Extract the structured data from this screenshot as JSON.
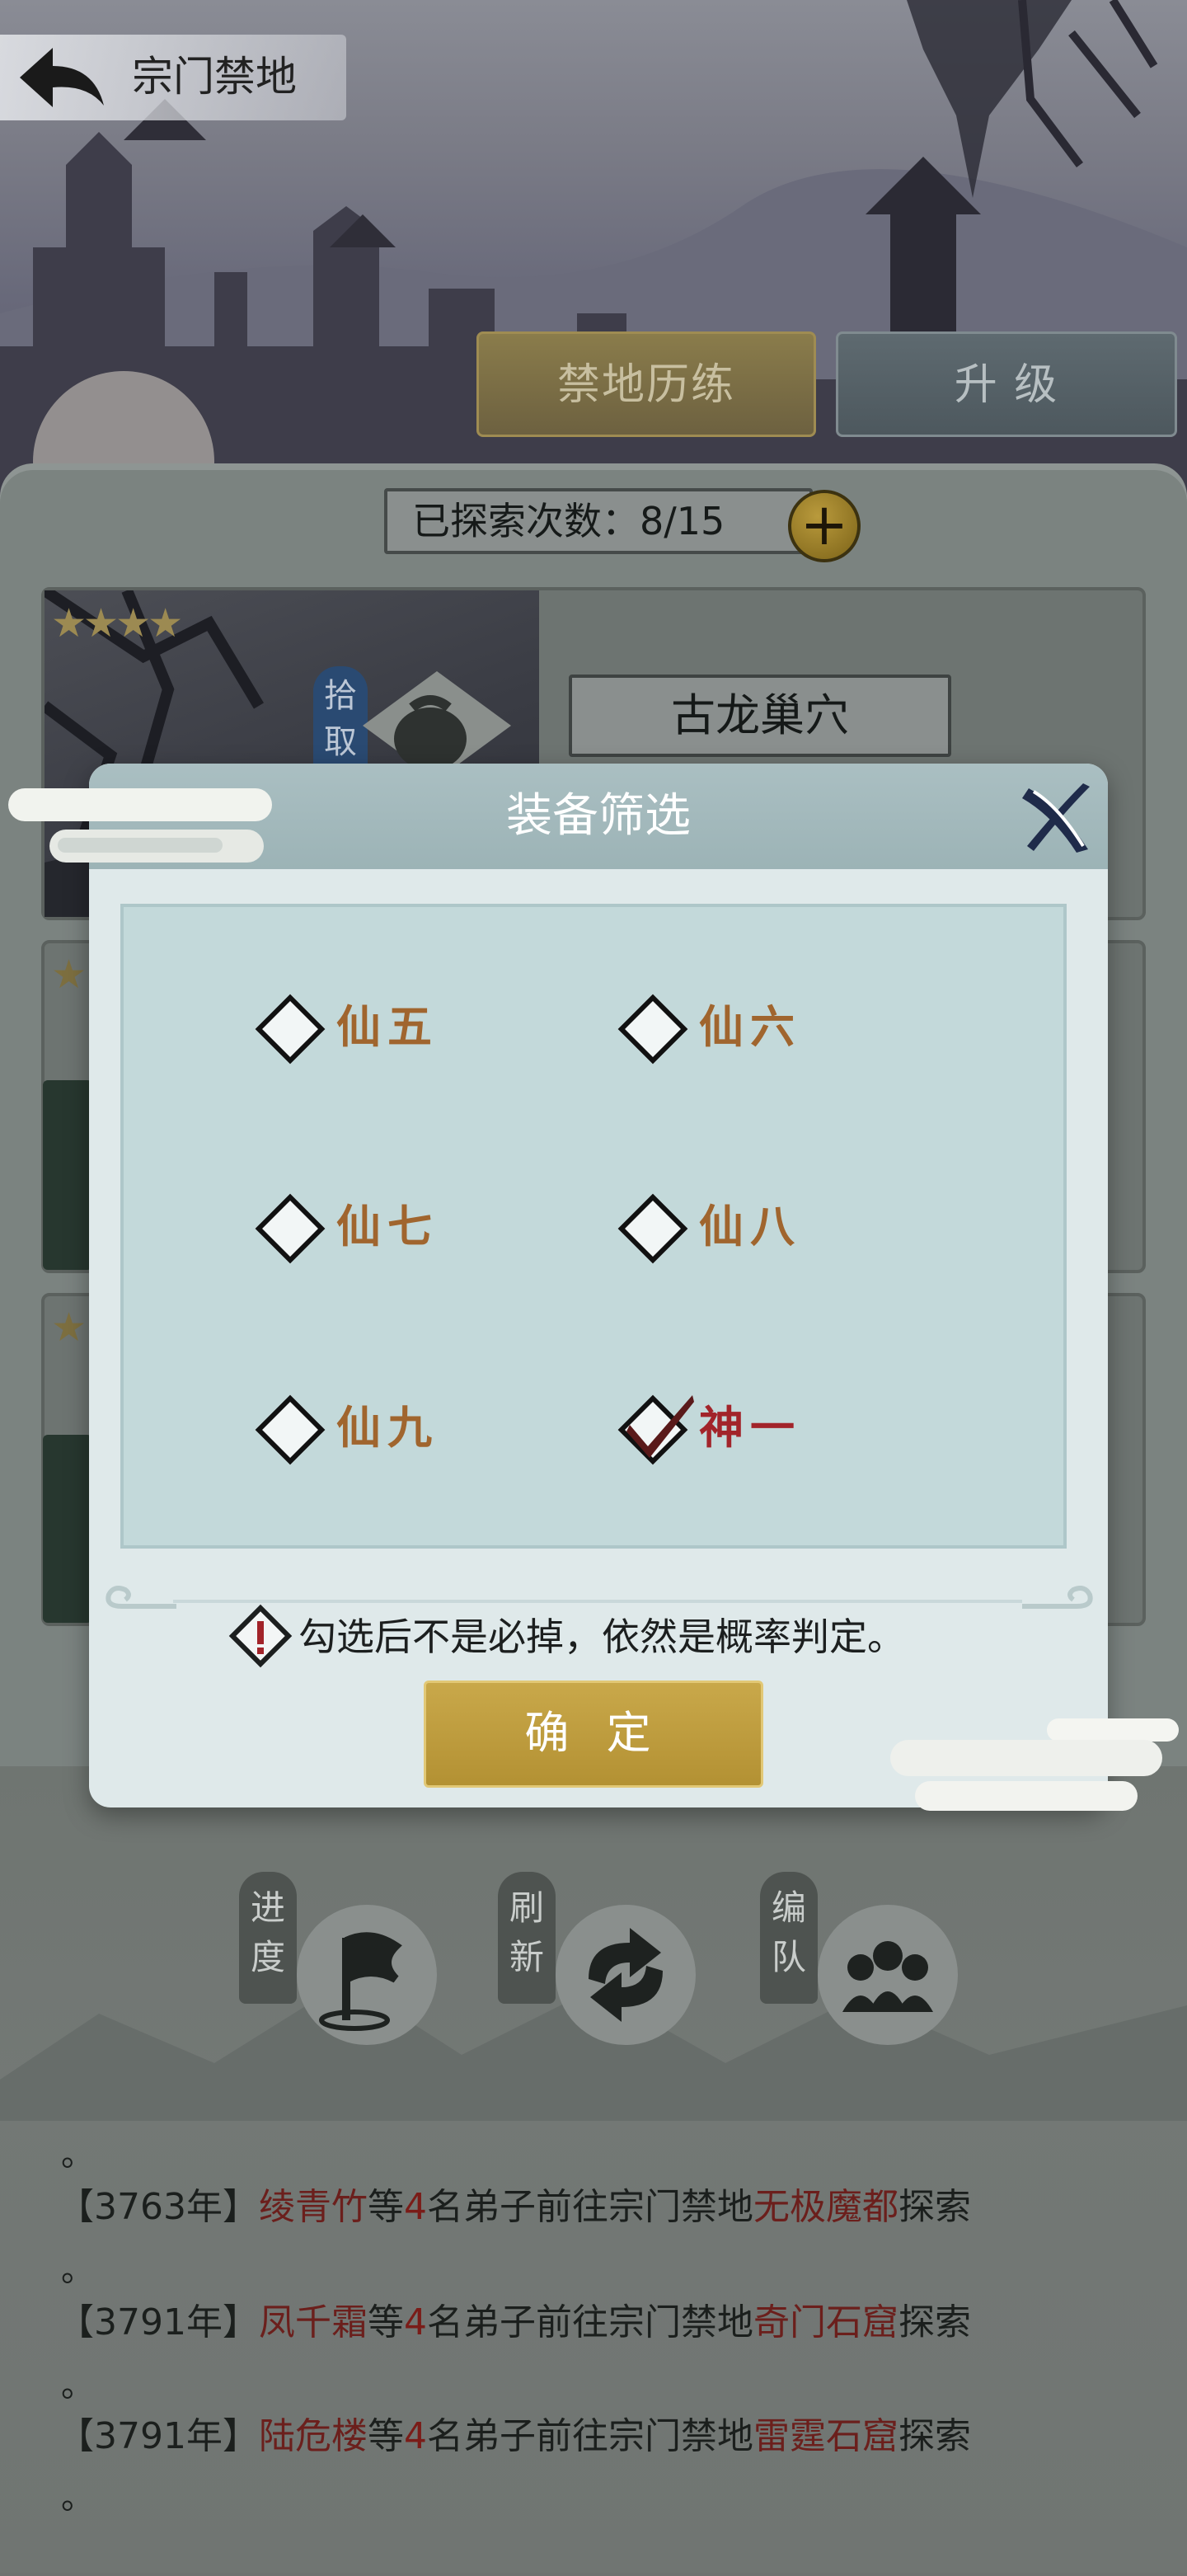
{
  "header": {
    "title": "宗门禁地"
  },
  "tabs": [
    {
      "label": "禁地历练",
      "active": true
    },
    {
      "label": "升 级",
      "active": false
    }
  ],
  "explore": {
    "label": "已探索次数：8/15"
  },
  "cards": [
    {
      "stars": "★★★★",
      "badge": "拾取",
      "location": "古龙巢穴"
    }
  ],
  "actions": [
    {
      "label": "进度",
      "icon": "flag-icon"
    },
    {
      "label": "刷新",
      "icon": "refresh-icon"
    },
    {
      "label": "编队",
      "icon": "team-icon"
    }
  ],
  "log": [
    {
      "year": "【3763年】",
      "who": "绫青竹",
      "mid1": "等",
      "count": "4",
      "mid2": "名弟子前往宗门禁地",
      "place": "无极魔都",
      "end": "探索"
    },
    {
      "year": "【3791年】",
      "who": "凤千霜",
      "mid1": "等",
      "count": "4",
      "mid2": "名弟子前往宗门禁地",
      "place": "奇门石窟",
      "end": "探索"
    },
    {
      "year": "【3791年】",
      "who": "陆危楼",
      "mid1": "等",
      "count": "4",
      "mid2": "名弟子前往宗门禁地",
      "place": "雷霆石窟",
      "end": "探索"
    }
  ],
  "log_dot": "。",
  "modal": {
    "title": "装备筛选",
    "options": [
      {
        "label": "仙五",
        "checked": false
      },
      {
        "label": "仙六",
        "checked": false
      },
      {
        "label": "仙七",
        "checked": false
      },
      {
        "label": "仙八",
        "checked": false
      },
      {
        "label": "仙九",
        "checked": false
      },
      {
        "label": "神一",
        "checked": true
      }
    ],
    "notice": "勾选后不是必掉，依然是概率判定。",
    "confirm": "确 定"
  },
  "colors": {
    "gold": "#c9a84a",
    "option_text": "#a0652e",
    "checked_text": "#a2242a",
    "highlight_text": "#6b1f1c"
  }
}
